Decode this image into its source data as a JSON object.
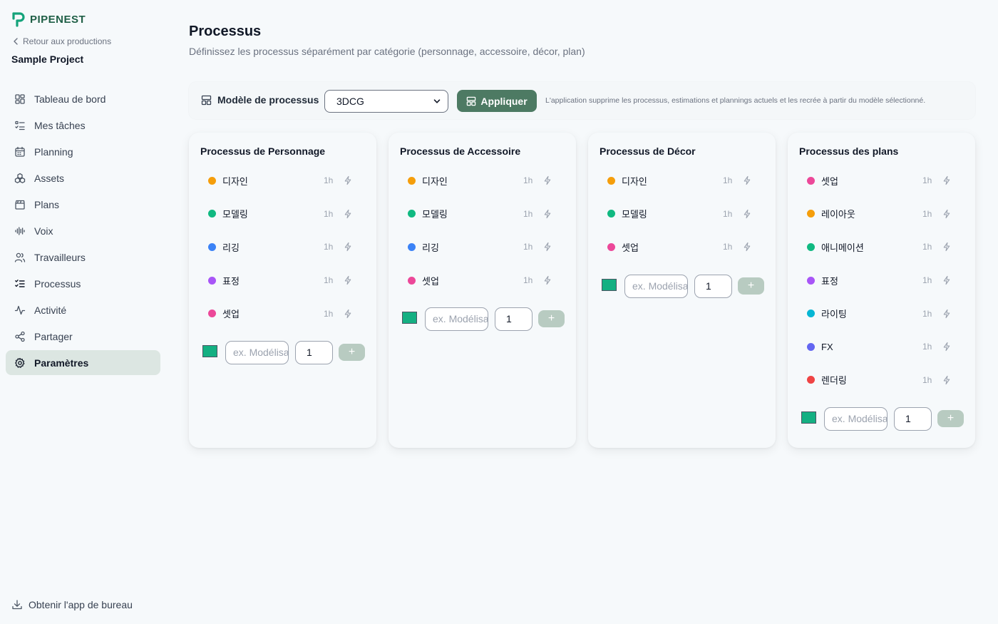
{
  "app": {
    "logo_text": "PIPENEST",
    "back_label": "Retour aux productions",
    "project_name": "Sample Project"
  },
  "sidebar": {
    "items": [
      {
        "label": "Tableau de bord",
        "icon": "dashboard-icon"
      },
      {
        "label": "Mes tâches",
        "icon": "task-list-icon"
      },
      {
        "label": "Planning",
        "icon": "calendar-icon"
      },
      {
        "label": "Assets",
        "icon": "assets-icon"
      },
      {
        "label": "Plans",
        "icon": "clapperboard-icon"
      },
      {
        "label": "Voix",
        "icon": "audio-wave-icon"
      },
      {
        "label": "Travailleurs",
        "icon": "users-icon"
      },
      {
        "label": "Processus",
        "icon": "process-list-icon"
      },
      {
        "label": "Activité",
        "icon": "activity-icon"
      },
      {
        "label": "Partager",
        "icon": "share-icon"
      },
      {
        "label": "Paramètres",
        "icon": "gear-icon",
        "active": true
      }
    ],
    "desktop_app_label": "Obtenir l'app de bureau"
  },
  "page": {
    "title": "Processus",
    "subtitle": "Définissez les processus séparément par catégorie (personnage, accessoire, décor, plan)"
  },
  "template_bar": {
    "label": "Modèle de processus",
    "selected": "3DCG",
    "apply_label": "Appliquer",
    "note": "L'application supprime les processus, estimations et plannings actuels et les recrée à partir du modèle sélectionné."
  },
  "colors": {
    "accent": "#4d7a63",
    "orange": "#f59e0b",
    "green": "#10b981",
    "blue": "#3b82f6",
    "purple": "#a855f7",
    "pink": "#ec4899",
    "cyan": "#06b6d4",
    "indigo": "#6366f1",
    "red": "#ef4444",
    "swatch": "#14b082"
  },
  "cards": [
    {
      "title": "Processus de Personnage",
      "tasks": [
        {
          "name": "디자인",
          "color": "#f59e0b",
          "duration": "1h"
        },
        {
          "name": "모델링",
          "color": "#10b981",
          "duration": "1h"
        },
        {
          "name": "리깅",
          "color": "#3b82f6",
          "duration": "1h"
        },
        {
          "name": "표정",
          "color": "#a855f7",
          "duration": "1h"
        },
        {
          "name": "셋업",
          "color": "#ec4899",
          "duration": "1h"
        }
      ],
      "add": {
        "placeholder": "ex. Modélisation",
        "quantity": "1",
        "button": "+"
      }
    },
    {
      "title": "Processus de Accessoire",
      "tasks": [
        {
          "name": "디자인",
          "color": "#f59e0b",
          "duration": "1h"
        },
        {
          "name": "모델링",
          "color": "#10b981",
          "duration": "1h"
        },
        {
          "name": "리깅",
          "color": "#3b82f6",
          "duration": "1h"
        },
        {
          "name": "셋업",
          "color": "#ec4899",
          "duration": "1h"
        }
      ],
      "add": {
        "placeholder": "ex. Modélisation",
        "quantity": "1",
        "button": "+"
      }
    },
    {
      "title": "Processus de Décor",
      "tasks": [
        {
          "name": "디자인",
          "color": "#f59e0b",
          "duration": "1h"
        },
        {
          "name": "모델링",
          "color": "#10b981",
          "duration": "1h"
        },
        {
          "name": "셋업",
          "color": "#ec4899",
          "duration": "1h"
        }
      ],
      "add": {
        "placeholder": "ex. Modélisation",
        "quantity": "1",
        "button": "+"
      }
    },
    {
      "title": "Processus des plans",
      "tasks": [
        {
          "name": "셋업",
          "color": "#ec4899",
          "duration": "1h"
        },
        {
          "name": "레이아웃",
          "color": "#f59e0b",
          "duration": "1h"
        },
        {
          "name": "애니메이션",
          "color": "#10b981",
          "duration": "1h"
        },
        {
          "name": "표정",
          "color": "#a855f7",
          "duration": "1h"
        },
        {
          "name": "라이팅",
          "color": "#06b6d4",
          "duration": "1h"
        },
        {
          "name": "FX",
          "color": "#6366f1",
          "duration": "1h"
        },
        {
          "name": "렌더링",
          "color": "#ef4444",
          "duration": "1h"
        }
      ],
      "add": {
        "placeholder": "ex. Modélisation",
        "quantity": "1",
        "button": "+"
      }
    }
  ]
}
